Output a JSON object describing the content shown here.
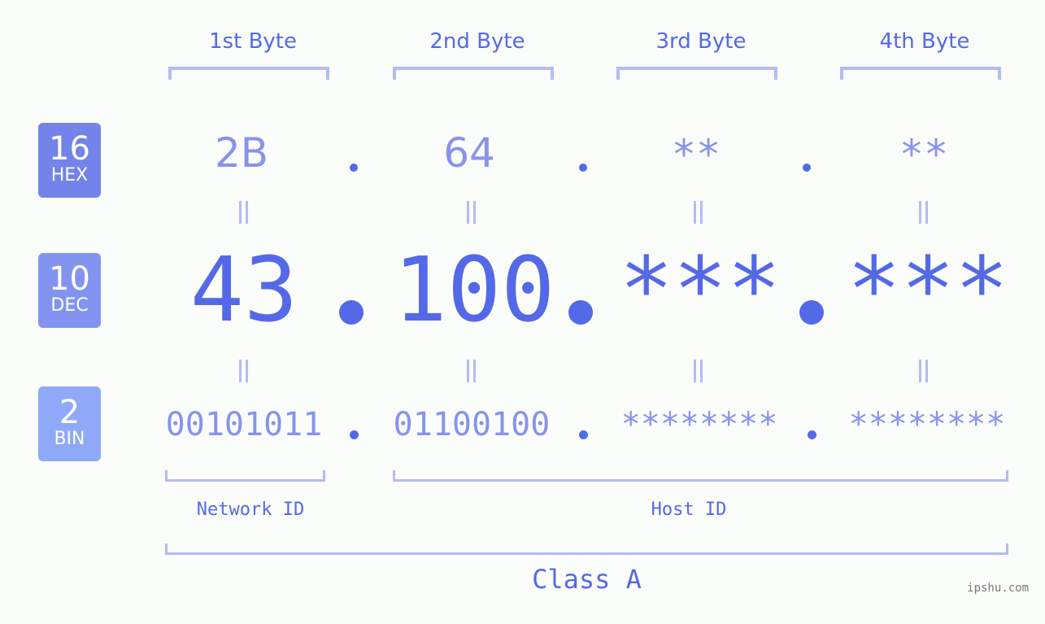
{
  "bases": [
    {
      "number": "16",
      "label": "HEX",
      "color": "#7383ea"
    },
    {
      "number": "10",
      "label": "DEC",
      "color": "#8394f0"
    },
    {
      "number": "2",
      "label": "BIN",
      "color": "#8fa8f8"
    }
  ],
  "byte_headers": [
    "1st Byte",
    "2nd Byte",
    "3rd Byte",
    "4th Byte"
  ],
  "hex": [
    "2B",
    "64",
    "**",
    "**"
  ],
  "dec": [
    "43",
    "100",
    "***",
    "***"
  ],
  "bin": [
    "00101011",
    "01100100",
    "********",
    "********"
  ],
  "separator": ".",
  "network_id_label": "Network ID",
  "host_id_label": "Host ID",
  "class_label": "Class A",
  "watermark": "ipshu.com",
  "colors": {
    "primary": "#5469e8",
    "light_value": "#8793ec",
    "bracket": "#b3bcf5",
    "background": "#fbfdfb"
  }
}
